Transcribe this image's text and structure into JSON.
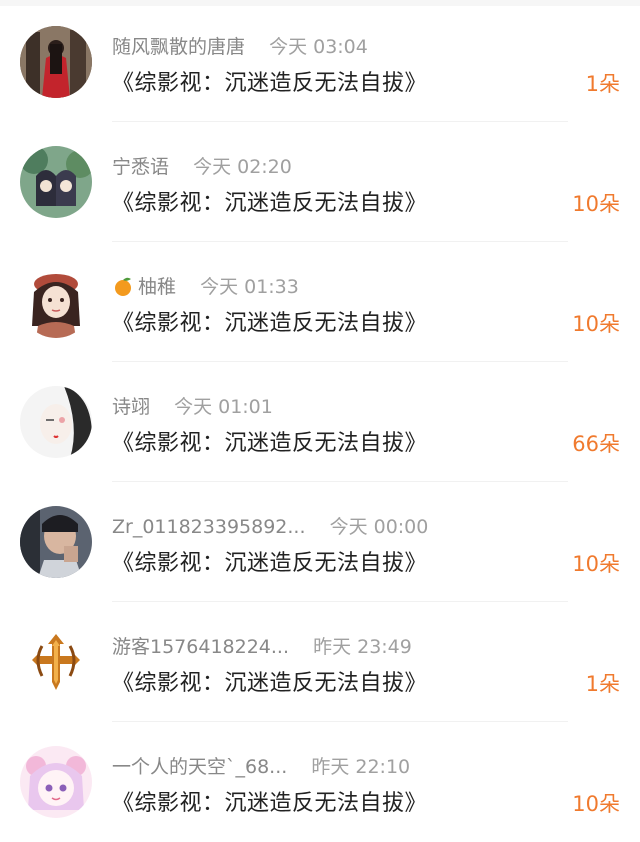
{
  "rows": [
    {
      "name": "随风飘散的唐唐",
      "time": "今天 03:04",
      "title": "《综影视：沉迷造反无法自拔》",
      "count": "1朵"
    },
    {
      "name": "宁悉语",
      "time": "今天 02:20",
      "title": "《综影视：沉迷造反无法自拔》",
      "count": "10朵"
    },
    {
      "name": "柚稚",
      "time": "今天 01:33",
      "title": "《综影视：沉迷造反无法自拔》",
      "count": "10朵"
    },
    {
      "name": "诗翊",
      "time": "今天 01:01",
      "title": "《综影视：沉迷造反无法自拔》",
      "count": "66朵"
    },
    {
      "name": "Zr_011823395892...",
      "time": "今天 00:00",
      "title": "《综影视：沉迷造反无法自拔》",
      "count": "10朵"
    },
    {
      "name": "游客1576418224...",
      "time": "昨天 23:49",
      "title": "《综影视：沉迷造反无法自拔》",
      "count": "1朵"
    },
    {
      "name": "一个人的天空`_68...",
      "time": "昨天 22:10",
      "title": "《综影视：沉迷造反无法自拔》",
      "count": "10朵"
    }
  ],
  "colors": {
    "count_orange": "#f07a2e",
    "name_gray": "#888888",
    "title_dark": "#222222"
  },
  "icons": {
    "tangerine_emoji": "tangerine-emoji-icon"
  }
}
